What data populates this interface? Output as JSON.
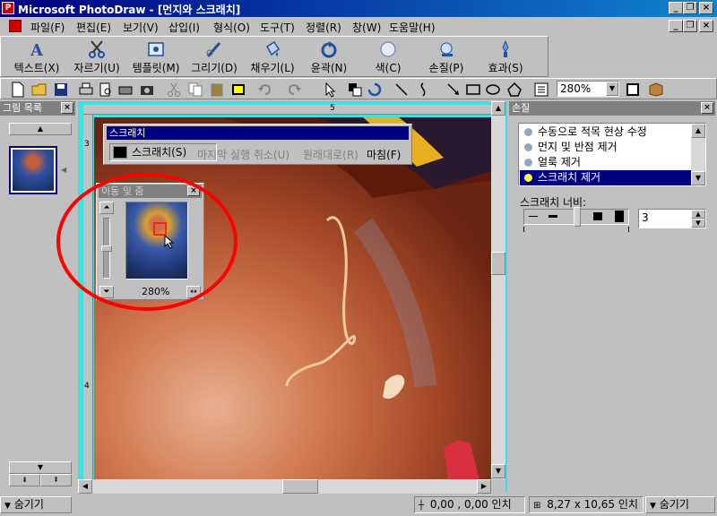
{
  "window": {
    "title": "Microsoft PhotoDraw - [먼지와 스크래치]",
    "controls": [
      "_",
      "❐",
      "×"
    ]
  },
  "menu": [
    "파일(F)",
    "편집(E)",
    "보기(V)",
    "삽입(I)",
    "형식(O)",
    "도구(T)",
    "정렬(R)",
    "창(W)",
    "도움말(H)"
  ],
  "big_toolbar": [
    {
      "label": "텍스트(X)",
      "icon": "text-icon"
    },
    {
      "label": "자르기(U)",
      "icon": "scissors-icon"
    },
    {
      "label": "템플릿(M)",
      "icon": "template-icon"
    },
    {
      "label": "그리기(D)",
      "icon": "draw-icon"
    },
    {
      "label": "채우기(L)",
      "icon": "fill-icon"
    },
    {
      "label": "윤곽(N)",
      "icon": "outline-icon"
    },
    {
      "label": "색(C)",
      "icon": "color-icon"
    },
    {
      "label": "손질(P)",
      "icon": "touchup-icon"
    },
    {
      "label": "효과(S)",
      "icon": "effects-icon"
    }
  ],
  "small_toolbar": {
    "zoom": "280%"
  },
  "picture_list": {
    "title": "그림 목록"
  },
  "scratch_panel": {
    "title": "스크래치",
    "buttons": [
      "스크래치(S)",
      "마지막 실행 취소(U)",
      "원래대로(R)",
      "마침(F)"
    ]
  },
  "pan_zoom": {
    "title": "이동 및 줌",
    "zoom": "280%"
  },
  "ruler": {
    "top_labels": [
      "5"
    ],
    "left_labels": [
      "3",
      "4"
    ]
  },
  "touchup_panel": {
    "title": "손질",
    "items": [
      "수동으로 적목 현상 수정",
      "먼지 및 반점 제거",
      "얼룩 제거",
      "스크래치 제거"
    ],
    "selected": 3,
    "width_label": "스크래치 너비:",
    "width_value": "3"
  },
  "status": {
    "left_toggle": "숨기기",
    "coords": "0,00 , 0,00 인치",
    "size": "8,27 x 10,65 인치",
    "right_toggle": "숨기기"
  },
  "colors": {
    "title_active": "#000080",
    "selection": "#000080",
    "canvas_border": "#40e0e0",
    "annotation_circle": "#ff0000"
  }
}
